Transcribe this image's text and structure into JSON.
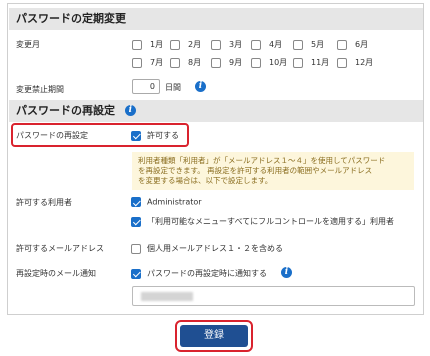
{
  "sections": {
    "periodic_change": "パスワードの定期変更",
    "reset": "パスワードの再設定"
  },
  "change_month": {
    "label": "変更月",
    "months": [
      "1月",
      "2月",
      "3月",
      "4月",
      "5月",
      "6月",
      "7月",
      "8月",
      "9月",
      "10月",
      "11月",
      "12月"
    ]
  },
  "prohibit_period": {
    "label": "変更禁止期間",
    "value": "0",
    "unit": "日間"
  },
  "reset": {
    "label": "パスワードの再設定",
    "allow_label": "許可する",
    "allow_checked": true,
    "note_lines": [
      "利用者種類「利用者」が「メールアドレス１～４」を使用してパスワード",
      "を再設定できます。 再設定を許可する利用者の範囲やメールアドレス",
      "を変更する場合は、以下で設定します。"
    ]
  },
  "allowed_users": {
    "label": "許可する利用者",
    "options": [
      {
        "text": "Administrator",
        "checked": true
      },
      {
        "text": "「利用可能なメニューすべてにフルコントロールを適用する」利用者",
        "checked": true
      }
    ]
  },
  "allowed_emails": {
    "label": "許可するメールアドレス",
    "option": "個人用メールアドレス１・２を含める",
    "checked": false
  },
  "reset_notify": {
    "label": "再設定時のメール通知",
    "option": "パスワードの再設定時に通知する",
    "checked": true
  },
  "info_glyph": "i",
  "submit_label": "登録",
  "colors": {
    "accent": "#1a6fc9",
    "submit": "#1f4f92",
    "highlight": "#d9232e",
    "note_bg": "#fdf6dc"
  }
}
